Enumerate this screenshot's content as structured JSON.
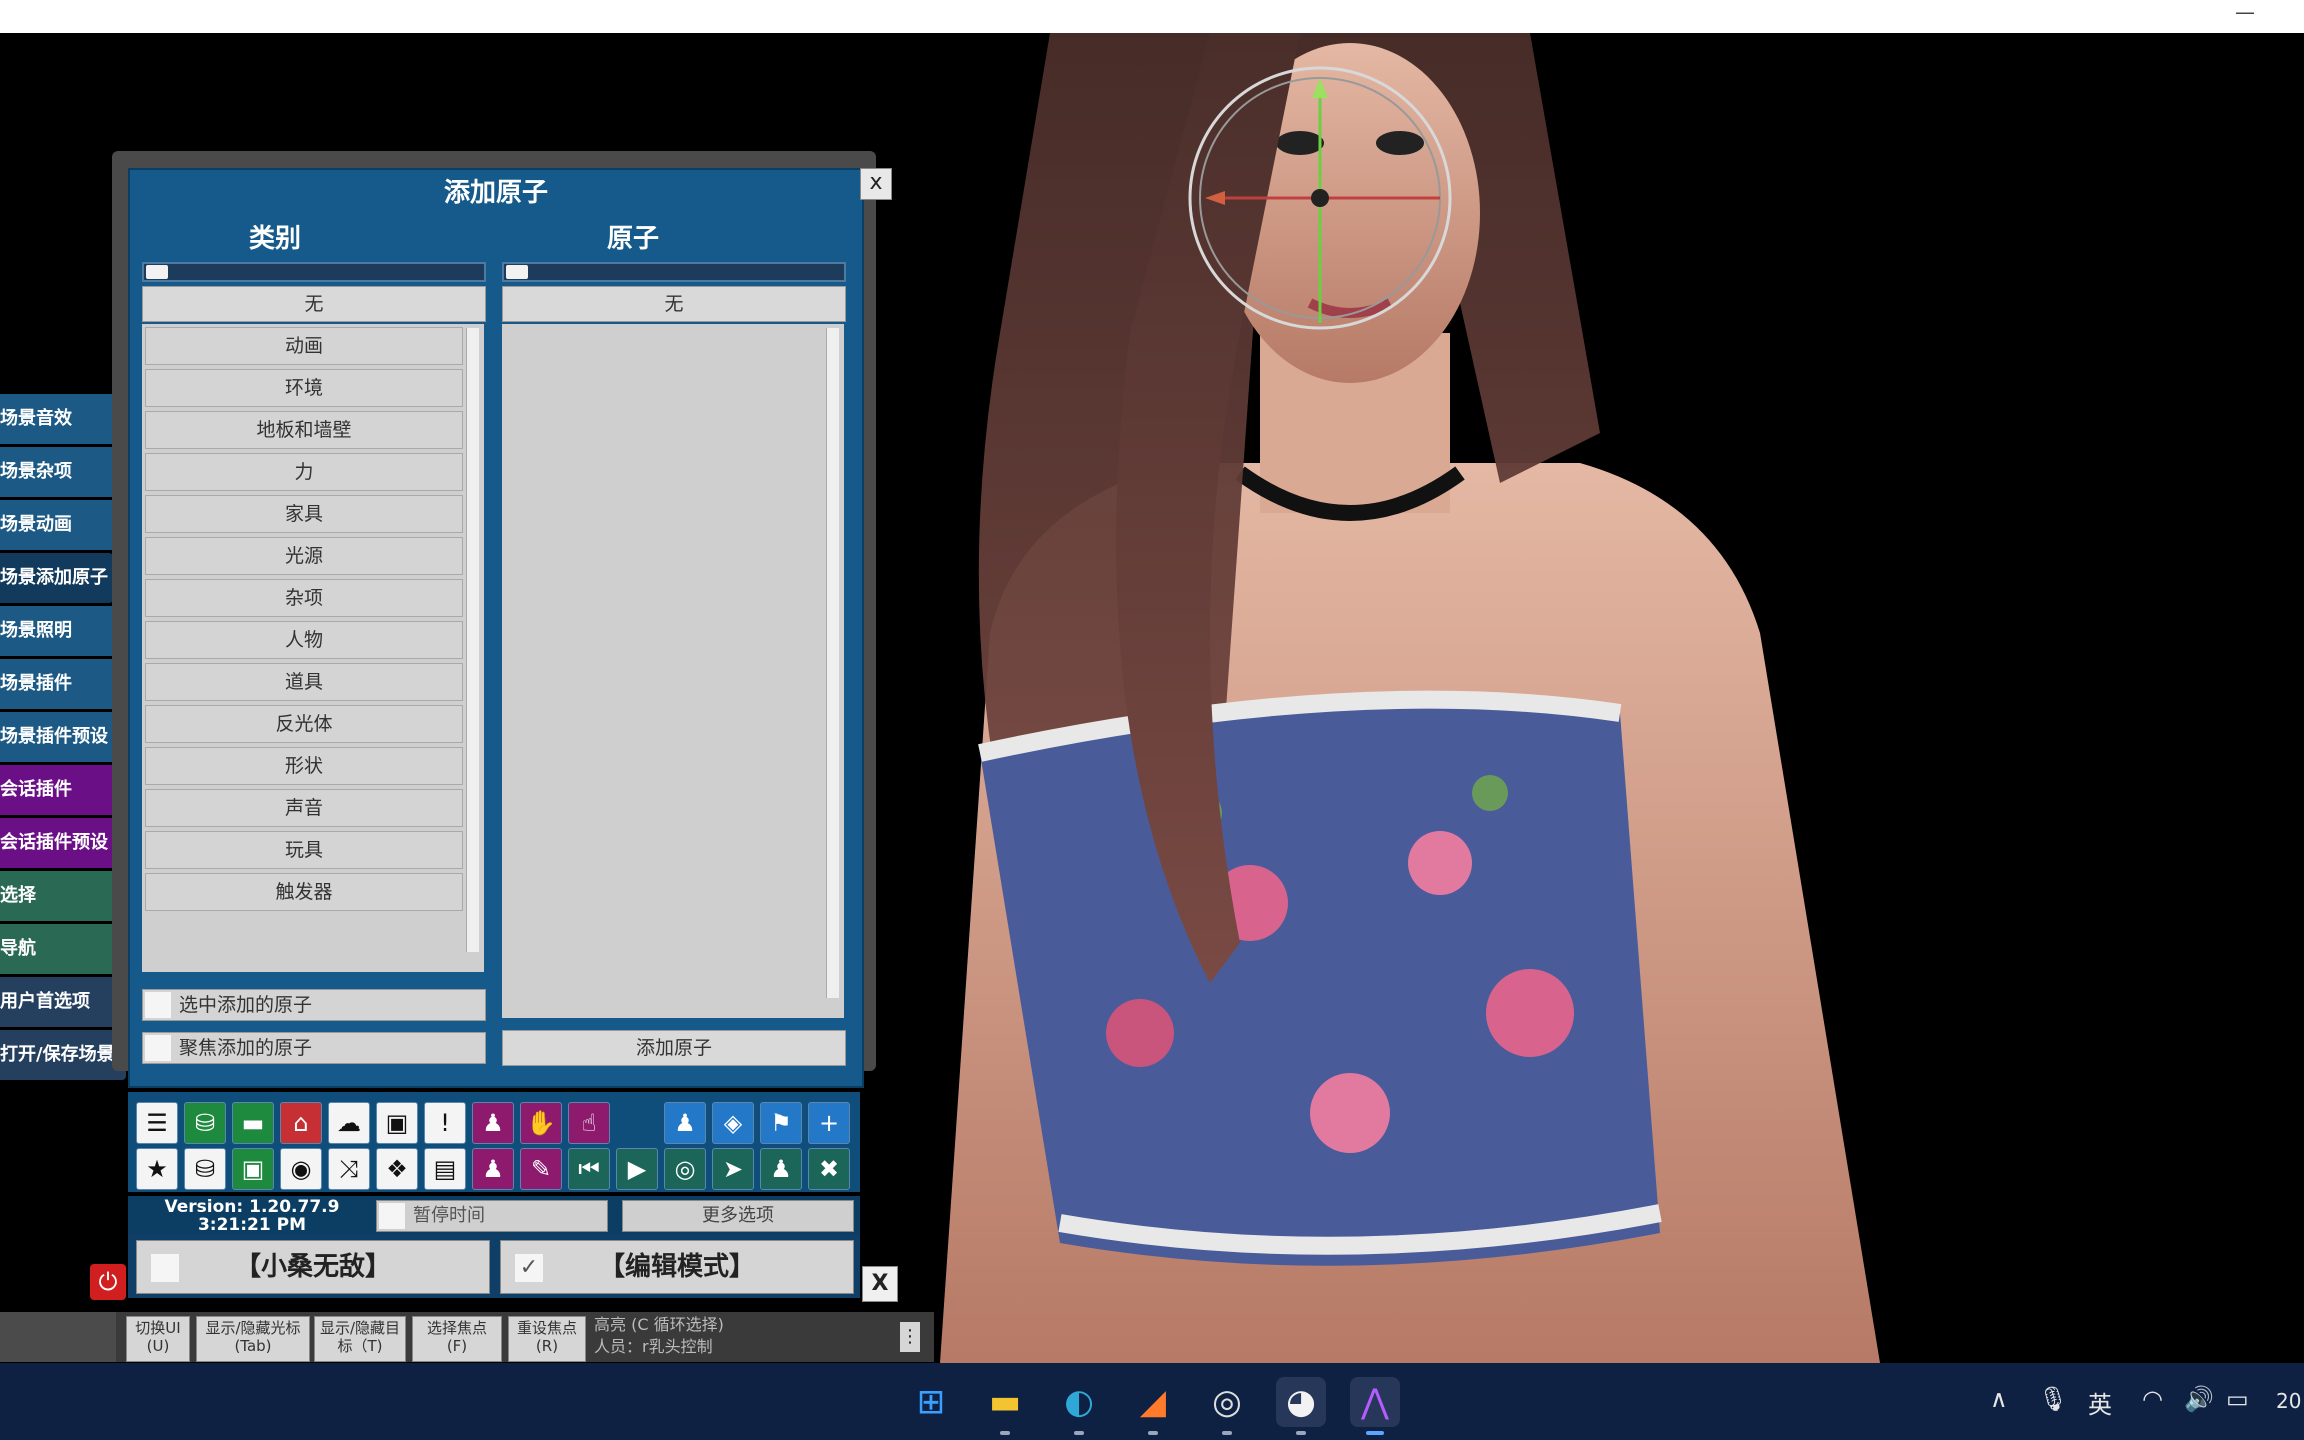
{
  "window": {
    "minimize_glyph": "—"
  },
  "sidebar": {
    "items": [
      {
        "label": "场景音效",
        "style": "blue"
      },
      {
        "label": "场景杂项",
        "style": "blue"
      },
      {
        "label": "场景动画",
        "style": "blue"
      },
      {
        "label": "场景添加原子",
        "style": "active"
      },
      {
        "label": "场景照明",
        "style": "blue"
      },
      {
        "label": "场景插件",
        "style": "blue"
      },
      {
        "label": "场景插件预设",
        "style": "blue"
      },
      {
        "label": "会话插件",
        "style": "purple"
      },
      {
        "label": "会话插件预设",
        "style": "purple"
      },
      {
        "label": "选择",
        "style": "green"
      },
      {
        "label": "导航",
        "style": "green"
      },
      {
        "label": "用户首选项",
        "style": "navy"
      },
      {
        "label": "打开/保存场景",
        "style": "navy"
      }
    ]
  },
  "dialog": {
    "title": "添加原子",
    "close": "x",
    "category_header": "类别",
    "atom_header": "原子",
    "category_none": "无",
    "atom_none": "无",
    "categories": [
      "动画",
      "环境",
      "地板和墙壁",
      "力",
      "家具",
      "光源",
      "杂项",
      "人物",
      "道具",
      "反光体",
      "形状",
      "声音",
      "玩具",
      "触发器"
    ],
    "select_added": "选中添加的原子",
    "focus_added": "聚焦添加的原子",
    "add_atom": "添加原子"
  },
  "toolbar": {
    "row1": [
      {
        "icon": "menu-icon",
        "glyph": "☰",
        "style": "white"
      },
      {
        "icon": "open-folder-icon",
        "glyph": "⛁",
        "style": "green"
      },
      {
        "icon": "folder-icon",
        "glyph": "▬",
        "style": "green"
      },
      {
        "icon": "scene-red-icon",
        "glyph": "⌂",
        "style": "red"
      },
      {
        "icon": "cloud-download-icon",
        "glyph": "☁",
        "style": "white"
      },
      {
        "icon": "package-icon",
        "glyph": "▣",
        "style": "white"
      },
      {
        "icon": "alert-icon",
        "glyph": "!",
        "style": "white"
      },
      {
        "icon": "person-add-icon",
        "glyph": "♟",
        "style": "purple"
      },
      {
        "icon": "hand-icon",
        "glyph": "✋",
        "style": "purple"
      },
      {
        "icon": "pointer-hand-icon",
        "glyph": "☝",
        "style": "purple"
      },
      {
        "icon": "person-icon",
        "glyph": "♟",
        "style": "blue"
      },
      {
        "icon": "unity-icon",
        "glyph": "◈",
        "style": "blue"
      },
      {
        "icon": "flag-icon",
        "glyph": "⚑",
        "style": "blue"
      },
      {
        "icon": "plus-icon",
        "glyph": "+",
        "style": "blue"
      }
    ],
    "row2": [
      {
        "icon": "star-icon",
        "glyph": "★",
        "style": "white"
      },
      {
        "icon": "save-folder-icon",
        "glyph": "⛁",
        "style": "white"
      },
      {
        "icon": "screenshot-folder-icon",
        "glyph": "▣",
        "style": "green"
      },
      {
        "icon": "camera-icon",
        "glyph": "◉",
        "style": "white"
      },
      {
        "icon": "node-icon",
        "glyph": "⤨",
        "style": "white"
      },
      {
        "icon": "dropbox-icon",
        "glyph": "❖",
        "style": "white"
      },
      {
        "icon": "document-icon",
        "glyph": "▤",
        "style": "white"
      },
      {
        "icon": "person-remove-icon",
        "glyph": "♟",
        "style": "purple"
      },
      {
        "icon": "wrench-hand-icon",
        "glyph": "✎",
        "style": "purple"
      },
      {
        "icon": "skip-back-icon",
        "glyph": "⏮",
        "style": "teal"
      },
      {
        "icon": "play-icon",
        "glyph": "▶",
        "style": "teal"
      },
      {
        "icon": "target-icon",
        "glyph": "◎",
        "style": "teal"
      },
      {
        "icon": "cursor-icon",
        "glyph": "➤",
        "style": "teal"
      },
      {
        "icon": "group-icon",
        "glyph": "♟",
        "style": "teal"
      },
      {
        "icon": "tools-icon",
        "glyph": "✖",
        "style": "teal"
      }
    ]
  },
  "status": {
    "version": "Version: 1.20.77.9",
    "time": "3:21:21 PM",
    "pause_time": "暂停时间",
    "more_options": "更多选项"
  },
  "modes": {
    "invincible": "【小桑无敌】",
    "edit_mode": "【编辑模式】",
    "edit_checked": "✓",
    "close": "X",
    "power": "⏻"
  },
  "hints": [
    {
      "line1": "切换UI",
      "line2": "(U)"
    },
    {
      "line1": "显示/隐藏光标",
      "line2": "(Tab)"
    },
    {
      "line1": "显示/隐藏目",
      "line2": "标（T)"
    },
    {
      "line1": "选择焦点",
      "line2": "(F)"
    },
    {
      "line1": "重设焦点",
      "line2": "(R)"
    }
  ],
  "hint_info": {
    "line1": "高亮 (C 循环选择)",
    "line2": "人员：r乳头控制",
    "menu": "⋮"
  },
  "taskbar": {
    "apps": [
      {
        "icon": "windows-start-icon",
        "glyph": "⊞",
        "color": "#3aa0ff"
      },
      {
        "icon": "file-explorer-icon",
        "glyph": "▬",
        "color": "#f4c430"
      },
      {
        "icon": "edge-browser-icon",
        "glyph": "◐",
        "color": "#2fa8d8"
      },
      {
        "icon": "app-orange-icon",
        "glyph": "◢",
        "color": "#ff7a2a"
      },
      {
        "icon": "obs-studio-icon",
        "glyph": "◎",
        "color": "#dddddd"
      },
      {
        "icon": "qq-penguin-icon",
        "glyph": "◕",
        "color": "#f2f2f2"
      },
      {
        "icon": "vam-app-icon",
        "glyph": "⋀",
        "color": "#b55cff"
      }
    ],
    "tray": {
      "chevron": "∧",
      "mic": "🎙",
      "ime": "英",
      "wifi": "◠",
      "volume": "🔊",
      "battery": "▭",
      "clock_partial": "20"
    }
  }
}
